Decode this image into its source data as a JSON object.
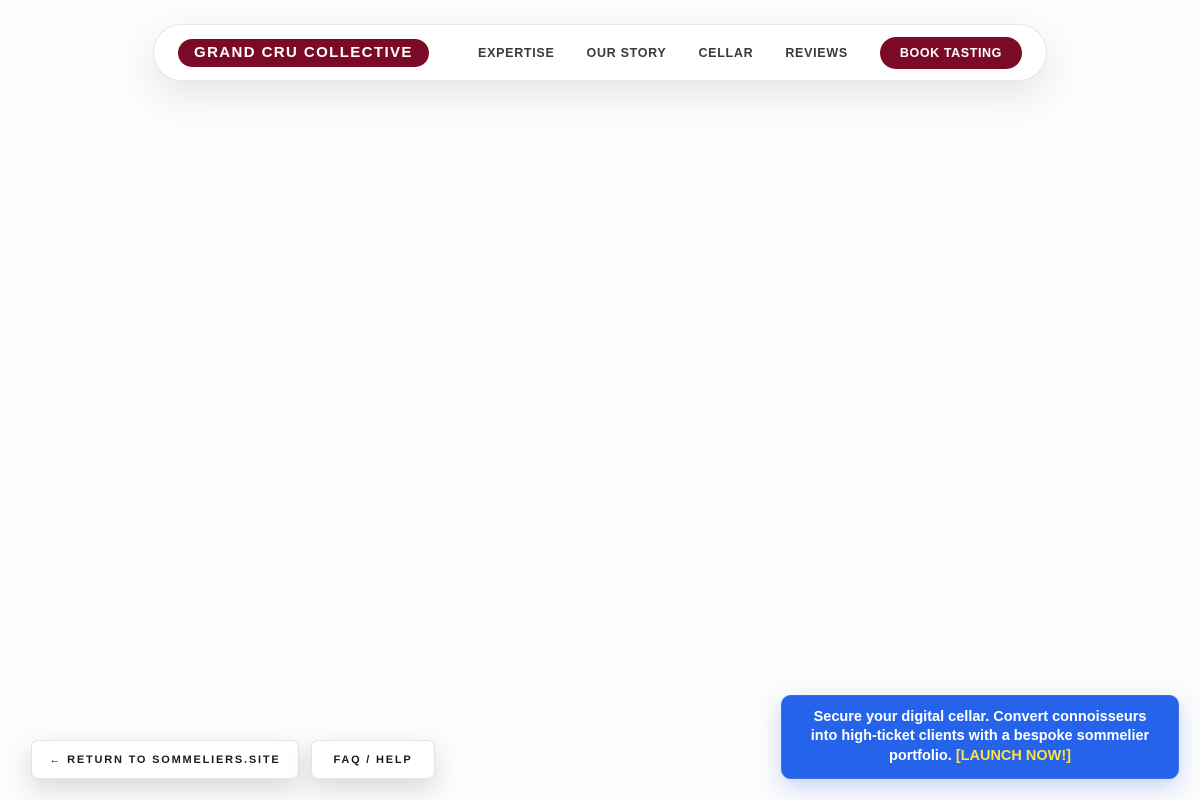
{
  "nav": {
    "brand": "GRAND CRU COLLECTIVE",
    "links": [
      "EXPERTISE",
      "OUR STORY",
      "CELLAR",
      "REVIEWS"
    ],
    "cta": "BOOK TASTING"
  },
  "footer": {
    "return_label": "← RETURN TO SOMMELIERS.SITE",
    "faq_label": "FAQ / HELP"
  },
  "promo": {
    "text": "Secure your digital cellar. Convert connoisseurs into high-ticket clients with a bespoke sommelier portfolio. ",
    "link": "[LAUNCH NOW!]"
  },
  "colors": {
    "brand": "#7b0a26",
    "promo_bg": "#2563eb",
    "promo_link": "#fde047",
    "page_bg": "#fcfcfc"
  }
}
